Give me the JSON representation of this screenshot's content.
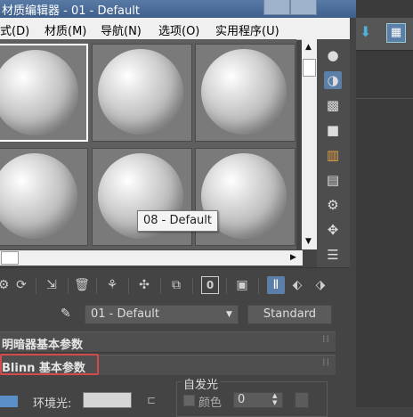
{
  "window": {
    "title": "材质编辑器 - 01 - Default"
  },
  "menu": [
    {
      "label": "式(D)"
    },
    {
      "label": "材质(M)"
    },
    {
      "label": "导航(N)"
    },
    {
      "label": "选项(O)"
    },
    {
      "label": "实用程序(U)"
    }
  ],
  "preview": {
    "tooltip": "08 - Default",
    "selected_slot": 1
  },
  "material": {
    "name": "01 - Default",
    "type_button": "Standard"
  },
  "rollouts": [
    {
      "title": "明暗器基本参数"
    },
    {
      "title": "Blinn 基本参数"
    }
  ],
  "blinn": {
    "ambient_label": "环境光:",
    "self_illumination": {
      "title": "自发光",
      "color_label": "颜色",
      "value": "0"
    }
  },
  "colors": {
    "title_bar": "#4a6a96",
    "highlight_border": "#d24a4a",
    "pressed_tool": "#5b7fa8"
  }
}
